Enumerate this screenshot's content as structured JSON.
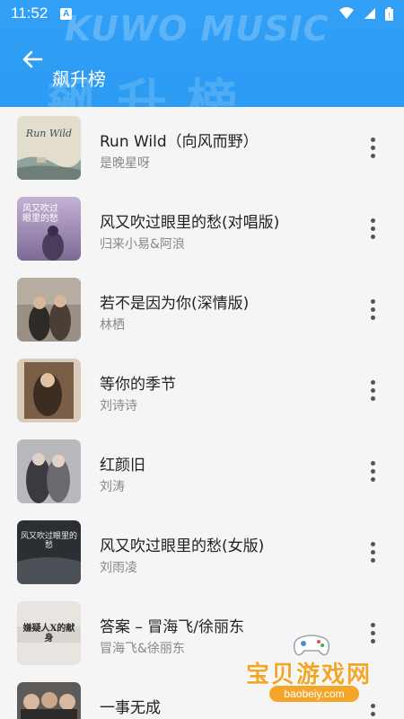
{
  "status_bar": {
    "time": "11:52",
    "notification_letter": "A",
    "icons": [
      "wifi-icon",
      "signal-icon",
      "battery-icon"
    ]
  },
  "header": {
    "brand_watermark": "KUWO MUSIC",
    "title": "飙升榜",
    "back_icon": "arrow-left-icon",
    "background_color": "#2c9bf3"
  },
  "songs": [
    {
      "title": "Run Wild（向风而野）",
      "artist": "是晚星呀",
      "cover_text": "Run Wild",
      "cover_bg": "#d9d4c6"
    },
    {
      "title": "风又吹过眼里的愁(对唱版)",
      "artist": "归来小易&阿浪",
      "cover_text": "风又吹过眼里的愁",
      "cover_bg": "#b9a7c8"
    },
    {
      "title": "若不是因为你(深情版)",
      "artist": "林栖",
      "cover_text": "",
      "cover_bg": "#8a8076"
    },
    {
      "title": "等你的季节",
      "artist": "刘诗诗",
      "cover_text": "",
      "cover_bg": "#c9b9a4"
    },
    {
      "title": "红颜旧",
      "artist": "刘涛",
      "cover_text": "",
      "cover_bg": "#9a9aa0"
    },
    {
      "title": "风又吹过眼里的愁(女版)",
      "artist": "刘雨凌",
      "cover_text": "风又吹过眼里的愁",
      "cover_bg": "#2f3338"
    },
    {
      "title": "答案 – 冒海飞/徐丽东",
      "artist": "冒海飞&徐丽东",
      "cover_text": "嫌疑人X的献身",
      "cover_bg": "#e6e3df"
    },
    {
      "title": "一事无成",
      "artist": "",
      "cover_text": "",
      "cover_bg": "#5d5a58"
    }
  ],
  "more_icon": "more-vertical-icon",
  "site_watermark": {
    "text": "宝贝游戏网",
    "url": "baobeiy.com",
    "color": "#f4a62a"
  }
}
